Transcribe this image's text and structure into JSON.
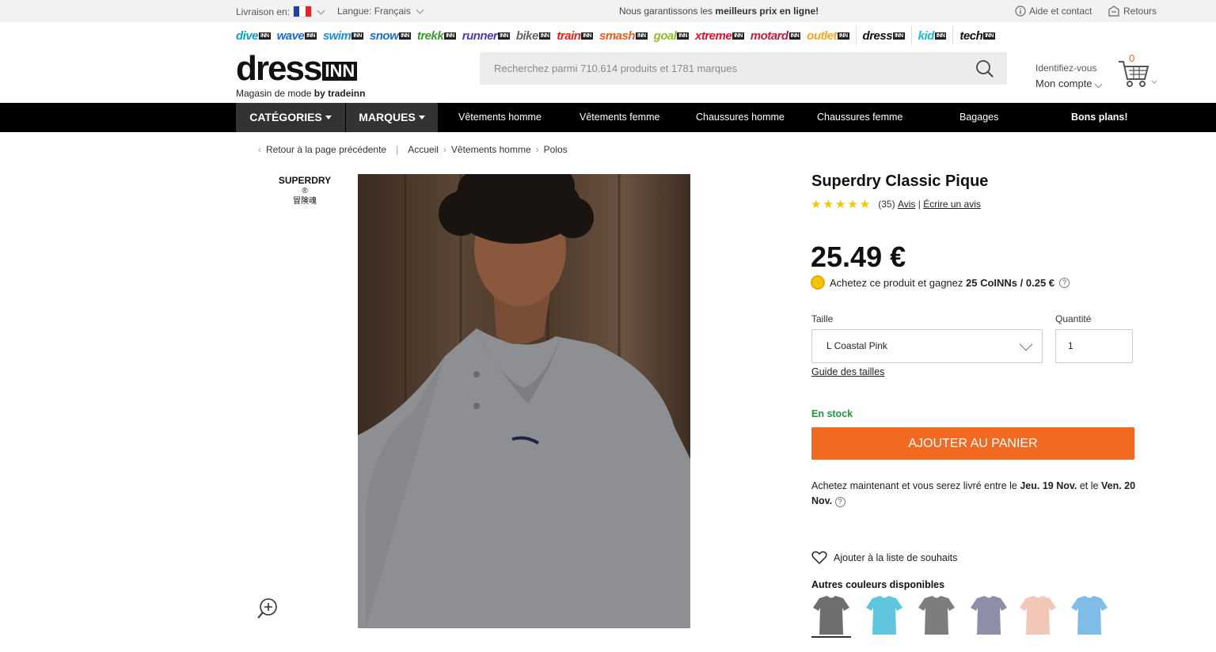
{
  "topbar": {
    "delivery_label": "Livraison en:",
    "language_label": "Langue: Français",
    "promo_prefix": "Nous garantissons les ",
    "promo_bold": "meilleurs prix en ligne!",
    "help_label": "Aide et contact",
    "returns_label": "Retours"
  },
  "brands": [
    {
      "name": "dive",
      "color": "#0aa3c2"
    },
    {
      "name": "wave",
      "color": "#1a6bd1"
    },
    {
      "name": "swim",
      "color": "#1d8fe0"
    },
    {
      "name": "snow",
      "color": "#1b70c9"
    },
    {
      "name": "trekk",
      "color": "#3d9a2f"
    },
    {
      "name": "runner",
      "color": "#4a3fb1"
    },
    {
      "name": "bike",
      "color": "#666666"
    },
    {
      "name": "train",
      "color": "#e2231a"
    },
    {
      "name": "smash",
      "color": "#ef5b1f"
    },
    {
      "name": "goal",
      "color": "#8cbf26"
    },
    {
      "name": "xtreme",
      "color": "#e8112d"
    },
    {
      "name": "motard",
      "color": "#c81d3a"
    },
    {
      "name": "outlet",
      "color": "#f5a623"
    },
    {
      "name": "dress",
      "color": "#111111"
    },
    {
      "name": "kid",
      "color": "#1fb5d6"
    },
    {
      "name": "tech",
      "color": "#111111"
    }
  ],
  "brand_suffix": "INN",
  "header": {
    "logo_main": "dress",
    "logo_inn": "INN",
    "logo_tagline": "Magasin de mode",
    "logo_by": "by tradeinn",
    "search_placeholder": "Recherchez parmi 710.614 produits et 1781 marques",
    "account_hint": "Identifiez-vous",
    "account_label": "Mon compte",
    "cart_count": "0"
  },
  "nav": {
    "categories": "CATÉGORIES",
    "brands": "MARQUES",
    "items": [
      "Vêtements homme",
      "Vêtements femme",
      "Chaussures homme",
      "Chaussures femme",
      "Bagages",
      "Bons plans!"
    ]
  },
  "breadcrumb": {
    "back": "Retour à la page précédente",
    "items": [
      "Accueil",
      "Vêtements homme",
      "Polos"
    ]
  },
  "product": {
    "brand_logo": "SUPERDRY",
    "brand_logo_mark": "®",
    "brand_logo_sub": "冒険魂",
    "title": "Superdry Classic Pique",
    "rating_stars": 5,
    "review_count": "(35)",
    "reviews_link": "Avis",
    "write_review": "Écrire un avis",
    "price": "25.49 €",
    "coins_text": "Achetez ce produit et gagnez",
    "coins_bold": "25 CoINNs / 0.25 €",
    "size_label": "Taille",
    "size_value": "L Coastal Pink",
    "qty_label": "Quantité",
    "qty_value": "1",
    "size_guide": "Guide des tailles",
    "stock": "En stock",
    "add_to_cart": "AJOUTER AU PANIER",
    "delivery_prefix": "Achetez maintenant et vous serez livré entre le",
    "delivery_date1": "Jeu. 19 Nov.",
    "delivery_mid": "et le",
    "delivery_date2": "Ven. 20 Nov.",
    "wishlist": "Ajouter à la liste de souhaits",
    "other_colors": "Autres couleurs disponibles",
    "swatch_colors": [
      "#6d6e70",
      "#5fc6dd",
      "#7b7d7f",
      "#8d8fa8",
      "#f2c7b6",
      "#7fbde8"
    ]
  }
}
